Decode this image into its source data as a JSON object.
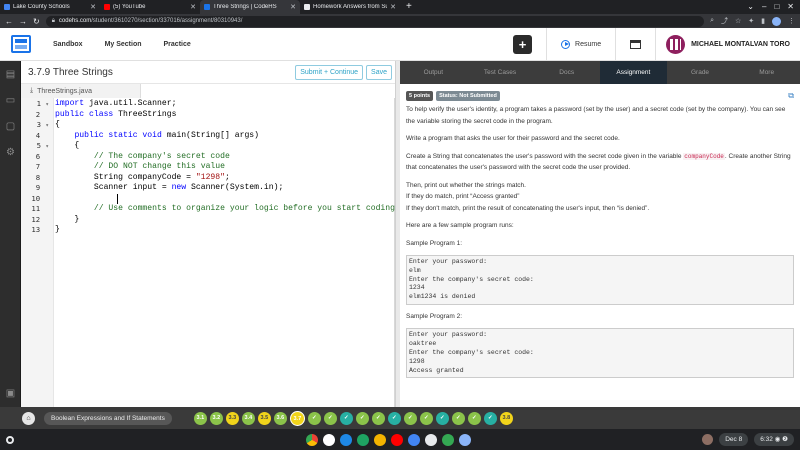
{
  "browser": {
    "tabs": [
      {
        "title": "Lake County Schools",
        "color": "#4285f4",
        "active": false
      },
      {
        "title": "(5) YouTube",
        "color": "#ff0000",
        "active": false
      },
      {
        "title": "Three Strings | CodeHS",
        "color": "#1a73e8",
        "active": true
      },
      {
        "title": "Homework Answers from Subje",
        "color": "#e8eaed",
        "active": false
      }
    ],
    "url_host": "codehs.com",
    "url_path": "/student/3610270/section/337016/assignment/80310943/"
  },
  "nav": {
    "links": [
      "Sandbox",
      "My Section",
      "Practice"
    ],
    "plus_label": "+",
    "resume_label": "Resume",
    "user_name": "MICHAEL MONTALVAN TORO"
  },
  "editor": {
    "title": "3.7.9 Three Strings",
    "submit_label": "Submit + Continue",
    "save_label": "Save",
    "file_tab": "ThreeStrings.java",
    "line_numbers": [
      "1",
      "2",
      "3",
      "4",
      "5",
      "6",
      "7",
      "8",
      "9",
      "10",
      "11",
      "12",
      "13"
    ]
  },
  "panel": {
    "tabs": [
      "Output",
      "Test Cases",
      "Docs",
      "Assignment",
      "Grade",
      "More"
    ],
    "active_tab": "Assignment",
    "points_badge": "5 points",
    "status_badge": "Status: Not Submitted",
    "p1": "To help verify the user's identity, a program takes a password (set by the user) and a secret code (set by the company). You can see the variable storing the secret code in the program.",
    "p2": "Write a program that asks the user for their password and the secret code.",
    "p3a": "Create a String that concatenates the user's password with the secret code given in the variable",
    "p3code": "companyCode",
    "p3b": ". Create another String that concatenates the user's password with the secret code the user provided.",
    "p4a": "Then, print out whether the strings match.",
    "p4b": "If they do match, print “Access granted”",
    "p4c": "If they don't match, print the result of concatenating the user's input, then “is denied”.",
    "p5": "Here are a few sample program runs:",
    "sample1_label": "Sample Program 1:",
    "sample1": "Enter your password:\nelm\nEnter the company's secret code:\n1234\nelm1234 is denied",
    "sample2_label": "Sample Program 2:",
    "sample2": "Enter your password:\noaktree\nEnter the company's secret code:\n1298\nAccess granted"
  },
  "bottom": {
    "home_icon": "home-icon",
    "crumb": "Boolean Expressions and If Statements",
    "pills": [
      "3.1",
      "3.2",
      "3.3",
      "3.4",
      "3.5",
      "3.6",
      "3.7",
      "",
      "",
      "",
      "",
      "",
      "",
      "",
      "",
      "",
      "",
      "",
      "",
      "3.8"
    ]
  },
  "shelf": {
    "date": "Dec 8",
    "time": "6:32"
  }
}
